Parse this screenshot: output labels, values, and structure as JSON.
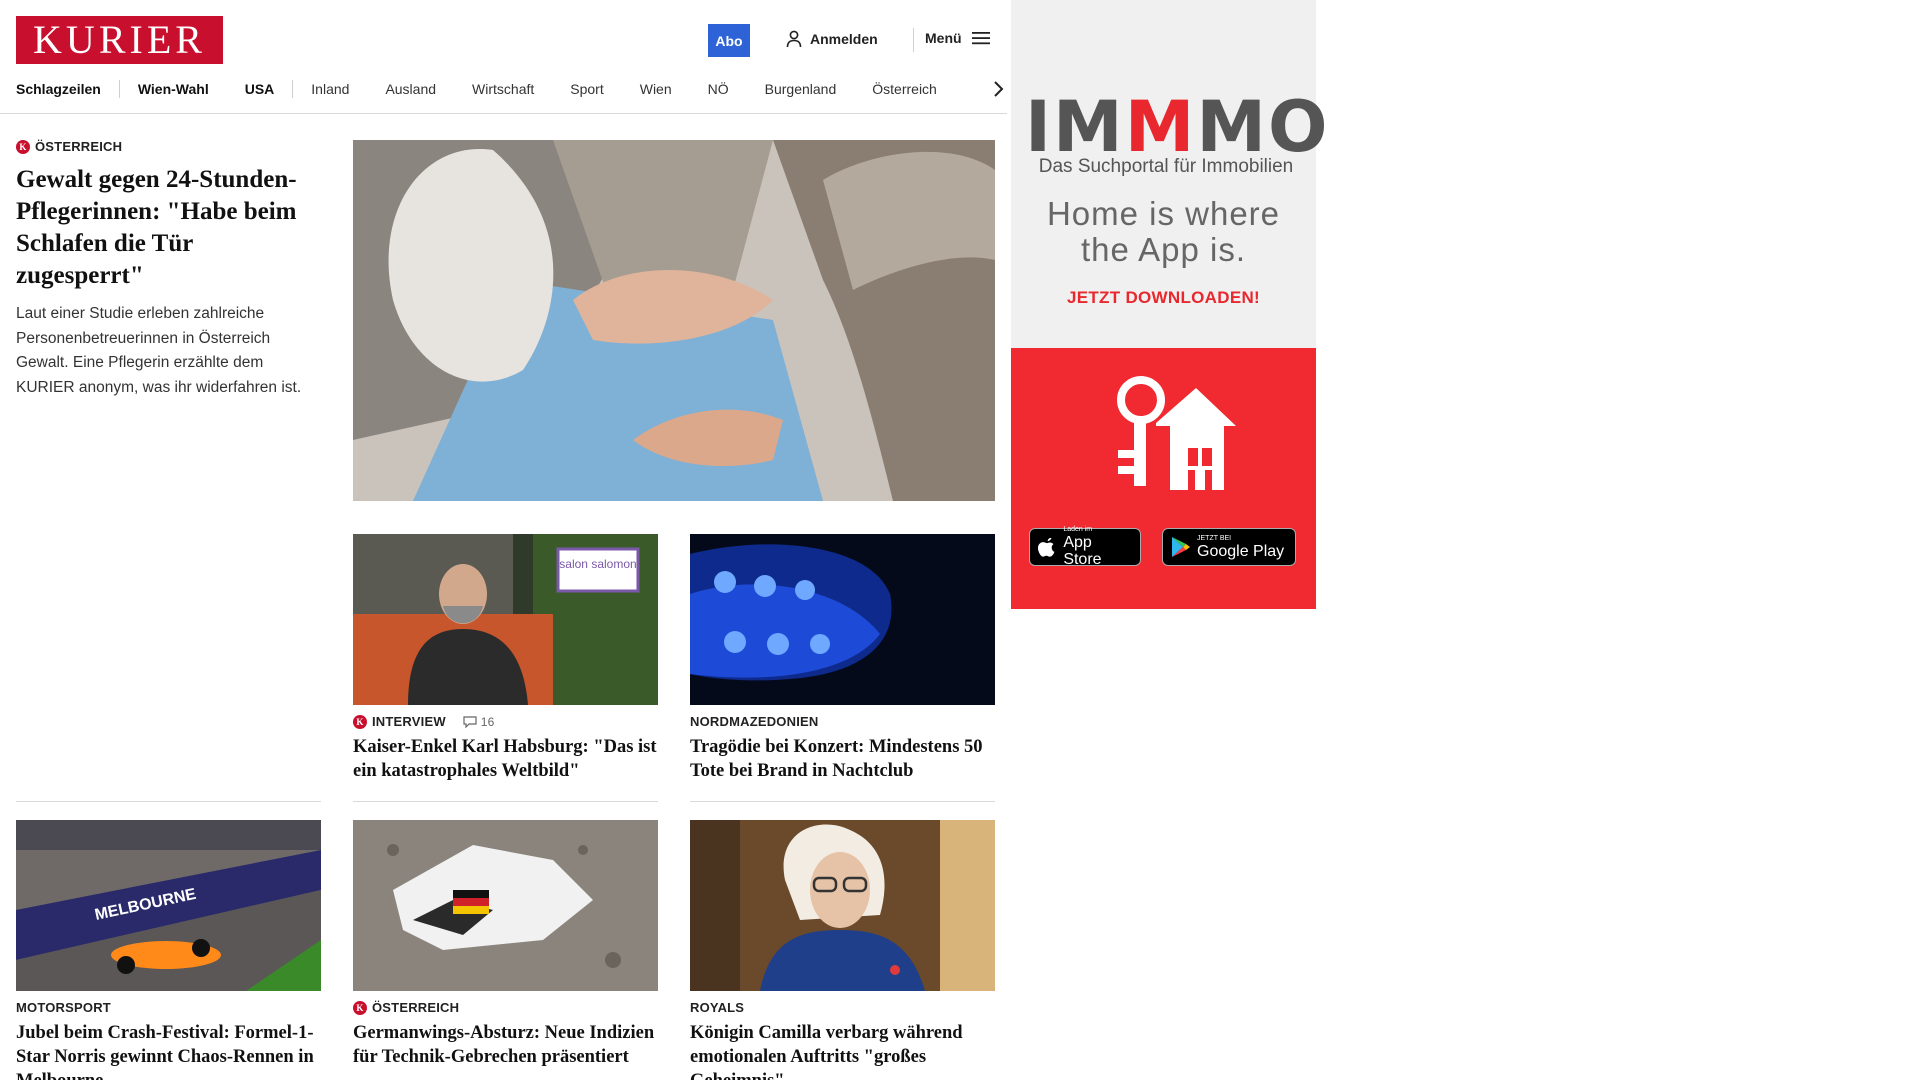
{
  "header": {
    "logo_text": "KURIER",
    "abo_label": "Abo",
    "login_label": "Anmelden",
    "menu_label": "Menü"
  },
  "nav": {
    "items": [
      "Schlagzeilen",
      "Wien-Wahl",
      "USA",
      "Inland",
      "Ausland",
      "Wirtschaft",
      "Sport",
      "Wien",
      "NÖ",
      "Burgenland",
      "Österreich"
    ]
  },
  "lead": {
    "kicker": "ÖSTERREICH",
    "title": "Gewalt gegen 24-Stunden-Pflegerinnen: \"Habe beim Schlafen die Tür zugesperrt\"",
    "teaser": "Laut einer Studie erleben zahlreiche Personenbetreuerinnen in Österreich Gewalt. Eine Pflegerin erzählte dem KURIER anonym, was ihr widerfahren ist."
  },
  "cards": [
    {
      "kicker": "INTERVIEW",
      "comments": "16",
      "title": "Kaiser-Enkel Karl Habsburg: \"Das ist ein katastrophales Weltbild\"",
      "img_label": "salon salomon"
    },
    {
      "kicker": "NORDMAZEDONIEN",
      "title": "Tragödie bei Konzert: Mindestens 50 Tote bei Brand in Nachtclub"
    },
    {
      "kicker": "MOTORSPORT",
      "title": "Jubel beim Crash-Festival: Formel-1-Star Norris gewinnt Chaos-Rennen in Melbourne",
      "img_label": "MELBOURNE"
    },
    {
      "kicker": "ÖSTERREICH",
      "title": "Germanwings-Absturz: Neue Indizien für Technik-Gebrechen präsentiert"
    },
    {
      "kicker": "ROYALS",
      "title": "Königin Camilla verbarg während emotionalen Auftritts \"großes Geheimnis\""
    }
  ],
  "ad": {
    "brand_left": "IM",
    "brand_red": "M",
    "brand_right": "MO",
    "subtitle": "Das Suchportal für Immobilien",
    "claim_line1": "Home is where",
    "claim_line2": "the App is.",
    "cta": "JETZT DOWNLOADEN!",
    "appstore_small": "Laden im",
    "appstore_big": "App Store",
    "googleplay_small": "JETZT BEI",
    "googleplay_big": "Google Play"
  },
  "colors": {
    "brand_red": "#c8102e",
    "abo_blue": "#2e63d8",
    "ad_red": "#f02a30"
  }
}
